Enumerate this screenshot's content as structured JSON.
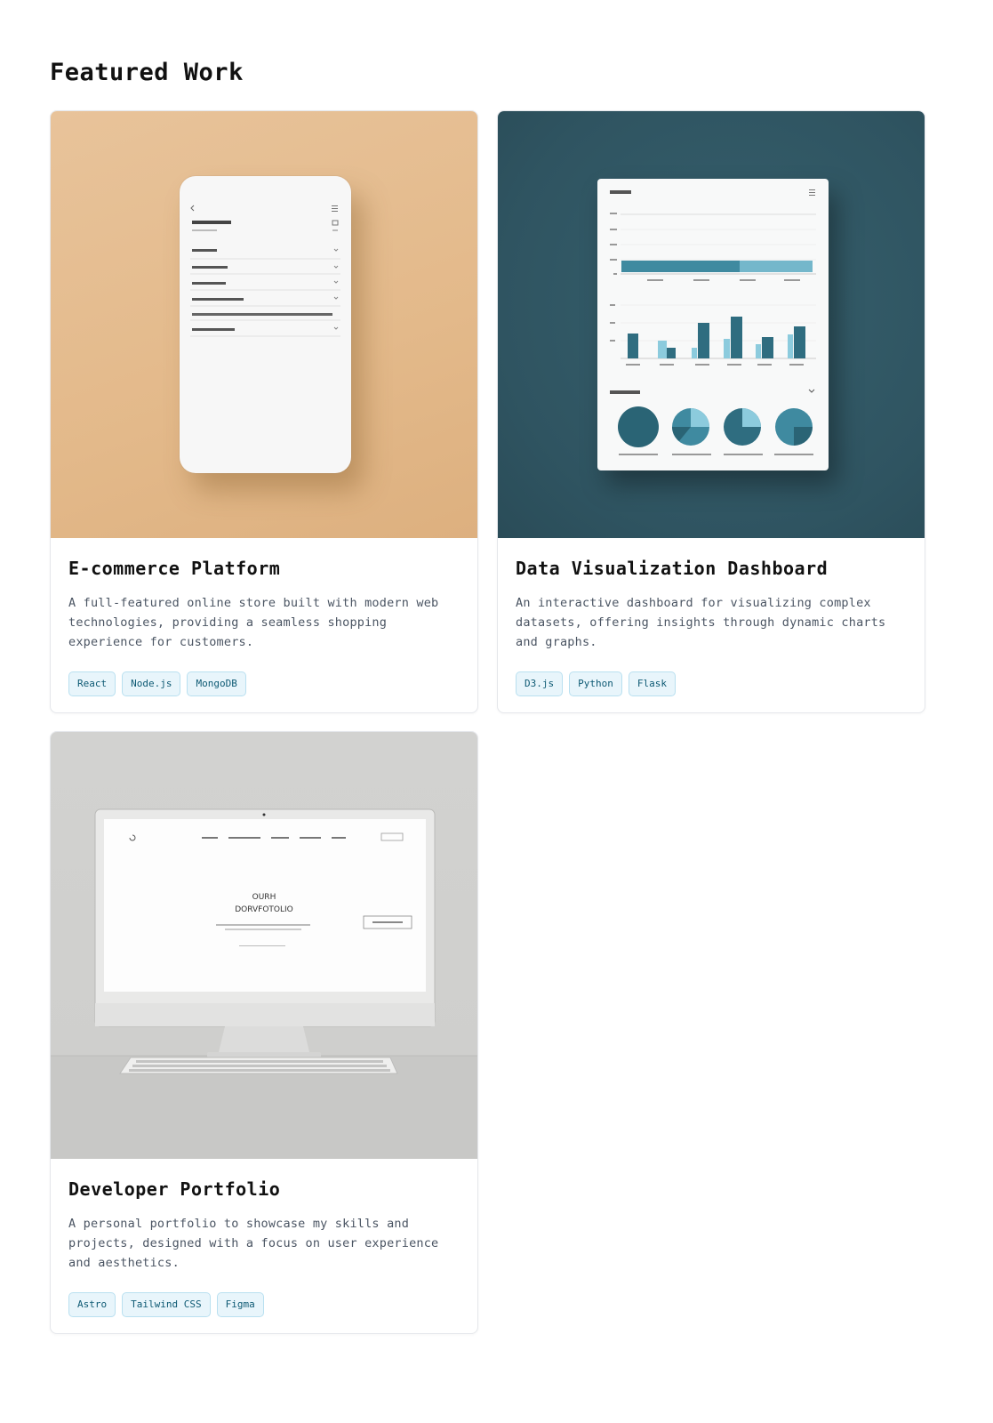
{
  "section": {
    "title": "Featured Work"
  },
  "projects": [
    {
      "title": "E-commerce Platform",
      "description": "A full-featured online store built with modern web technologies, providing a seamless shopping experience for customers.",
      "tags": [
        "React",
        "Node.js",
        "MongoDB"
      ],
      "image_icon": "phone-mockup-image",
      "image_bg": "#e3b98a"
    },
    {
      "title": "Data Visualization Dashboard",
      "description": "An interactive dashboard for visualizing complex datasets, offering insights through dynamic charts and graphs.",
      "tags": [
        "D3.js",
        "Python",
        "Flask"
      ],
      "image_icon": "dashboard-mockup-image",
      "image_bg": "#2f5461"
    },
    {
      "title": "Developer Portfolio",
      "description": "A personal portfolio to showcase my skills and projects, designed with a focus on user experience and aesthetics.",
      "tags": [
        "Astro",
        "Tailwind CSS",
        "Figma"
      ],
      "image_icon": "desktop-monitor-mockup-image",
      "image_bg": "#cfcfcd"
    }
  ],
  "mockup_text": {
    "monitor_heading_line1": "OURH",
    "monitor_heading_line2": "DORVFOTOLIO"
  },
  "colors": {
    "tag_text": "#0e5a74",
    "tag_bg": "#e8f5fb",
    "tag_border": "#b9e0f0",
    "dash_accent": "#2f6d80",
    "dash_light": "#8ccbdd"
  }
}
